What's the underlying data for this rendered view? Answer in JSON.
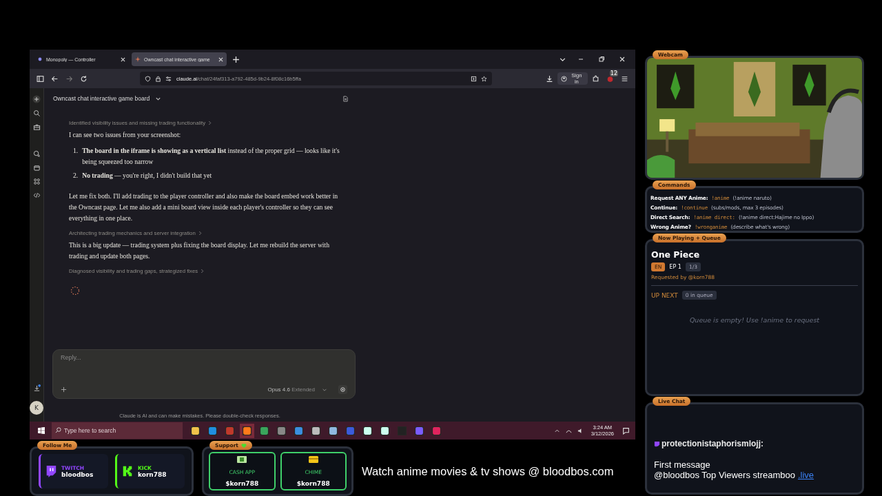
{
  "browser": {
    "tabs": [
      {
        "title": "Monopoly — Controller",
        "selected": false
      },
      {
        "title": "Owncast chat interactive game",
        "selected": true
      }
    ],
    "url_host": "claude.ai",
    "url_path": "/chat/24faf313-a792-485d-9b24-8f08c16b5ffa",
    "sign_in": "Sign in",
    "badge": "12"
  },
  "chat": {
    "title": "Owncast chat interactive game board",
    "avatar": "K",
    "blocks": [
      {
        "kind": "thinking",
        "text": "Identified visibility issues and missing trading functionality"
      },
      {
        "kind": "paragraph",
        "text": "I can see two issues from your screenshot:"
      },
      {
        "kind": "list",
        "items": [
          {
            "number": "1.",
            "text": "**The board in the iframe is showing as a vertical list** instead of the proper grid — looks like it's being squeezed too narrow"
          },
          {
            "number": "2.",
            "text": "**No trading** — you're right, I didn't build that yet"
          }
        ]
      },
      {
        "kind": "paragraph",
        "text": "Let me fix both. I'll add trading to the player controller and also make the board embed work better in the Owncast page. Let me also add a mini board view inside each player's controller so they can see everything in one place."
      },
      {
        "kind": "thinking",
        "text": "Architecting trading mechanics and server integration"
      },
      {
        "kind": "paragraph",
        "text": "This is a big update — trading system plus fixing the board display. Let me rebuild the server with trading and update both pages."
      },
      {
        "kind": "thinking",
        "text": "Diagnosed visibility and trading gaps, strategized fixes"
      }
    ],
    "loading": true,
    "composer": {
      "placeholder": "Reply...",
      "model": "Opus 4.6",
      "mode": "Extended"
    },
    "disclaimer": "Claude is AI and can make mistakes. Please double-check responses."
  },
  "taskbar": {
    "search_placeholder": "Type here to search",
    "time": "3:24 AM",
    "date": "3/12/2026"
  },
  "webcam": {
    "title": "Webcam",
    "kind": "picture"
  },
  "commands": {
    "title": "Commands",
    "items": [
      {
        "label": "Request ANY Anime:",
        "command": "!anime",
        "example": "(!anime naruto)"
      },
      {
        "label": "Continue:",
        "command": "!continue",
        "example": "(subs/mods, max 3 episodes)"
      },
      {
        "label": "Direct Search:",
        "command": "!anime direct:",
        "example": "(!anime direct:Hajime no Ippo)"
      },
      {
        "label": "Wrong Anime?",
        "command": "!wronganime",
        "example": "(describe what's wrong)"
      }
    ]
  },
  "now_playing": {
    "title": "Now Playing + Queue",
    "show": "One Piece",
    "language": "EN",
    "episode": "EP 1",
    "progress": "1/3",
    "requested_by": "Requested by @korn788",
    "up_next": "UP NEXT",
    "queue_count": "0 in queue",
    "empty_message": "Queue is empty! Use !anime to request"
  },
  "live_chat": {
    "title": "Live Chat",
    "messages": [
      {
        "user": "protectionistaphorismlojj:",
        "lines": [
          "First message"
        ],
        "text": "@bloodbos Top Viewers streamboo",
        "link": ".live"
      }
    ]
  },
  "follow": {
    "title": "Follow Me",
    "items": [
      {
        "kind": "twitch",
        "platform": "TWITCH",
        "handle": "bloodbos"
      },
      {
        "kind": "kick",
        "platform": "KICK",
        "handle": "korn788"
      }
    ]
  },
  "support": {
    "title": "Support",
    "items": [
      {
        "kind": "cashapp",
        "name": "CASH APP",
        "handle": "$korn788"
      },
      {
        "kind": "chime",
        "name": "CHIME",
        "handle": "$korn788"
      }
    ]
  },
  "banner": "Watch anime movies & tv shows @ bloodbos.com"
}
